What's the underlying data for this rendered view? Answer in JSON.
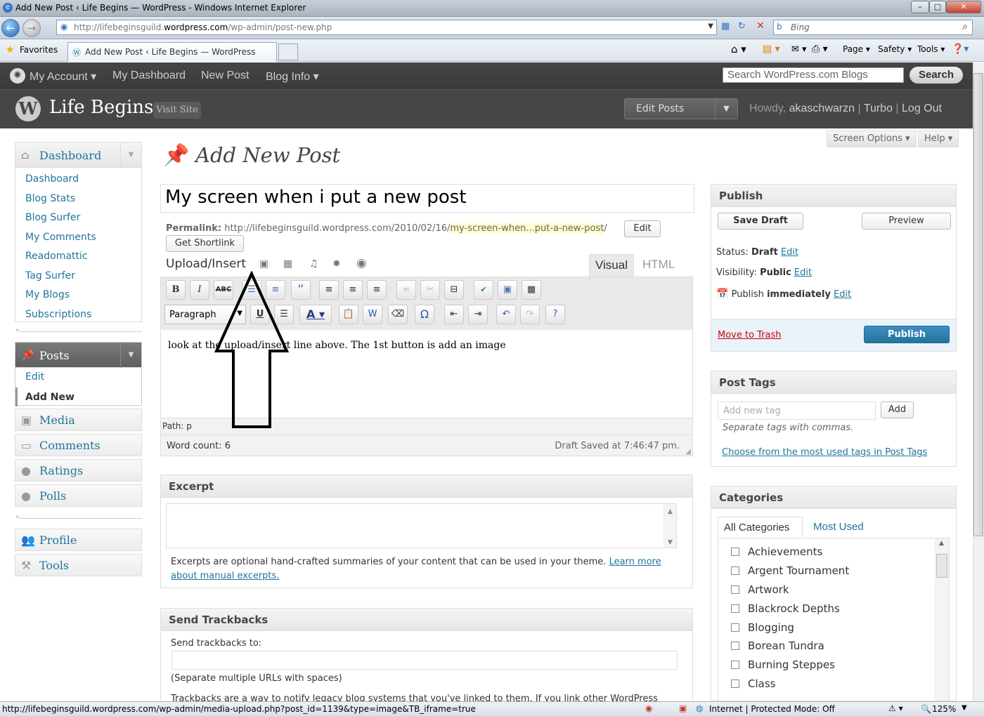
{
  "browser": {
    "window_title": "Add New Post ‹ Life Begins — WordPress - Windows Internet Explorer",
    "url_prefix": "http://lifebeginsguild.",
    "url_domain": "wordpress.com",
    "url_path": "/wp-admin/post-new.php",
    "search_placeholder": "Bing",
    "favorites_label": "Favorites",
    "tab_title": "Add New Post ‹ Life Begins — WordPress",
    "cmd_page": "Page ▾",
    "cmd_safety": "Safety ▾",
    "cmd_tools": "Tools ▾",
    "status_url": "http://lifebeginsguild.wordpress.com/wp-admin/media-upload.php?post_id=1139&type=image&TB_iframe=true",
    "status_zone": "Internet | Protected Mode: Off",
    "zoom": "125%"
  },
  "adminbar": {
    "my_account": "My Account ▾",
    "my_dashboard": "My Dashboard",
    "new_post": "New Post",
    "blog_info": "Blog Info ▾",
    "search_placeholder": "Search WordPress.com Blogs",
    "search_button": "Search"
  },
  "header": {
    "site_title": "Life Begins",
    "visit_site": "Visit Site",
    "edit_posts": "Edit Posts",
    "howdy": "Howdy,",
    "username": "akaschwarzn",
    "turbo": "Turbo",
    "logout": "Log Out",
    "sep": "|"
  },
  "sidebar": {
    "dashboard": "Dashboard",
    "dashboard_items": [
      "Dashboard",
      "Blog Stats",
      "Blog Surfer",
      "My Comments",
      "Readomattic",
      "Tag Surfer",
      "My Blogs",
      "Subscriptions"
    ],
    "posts": "Posts",
    "posts_items": [
      "Edit",
      "Add New"
    ],
    "media": "Media",
    "comments": "Comments",
    "ratings": "Ratings",
    "polls": "Polls",
    "profile": "Profile",
    "tools": "Tools"
  },
  "main": {
    "screen_options": "Screen Options ▾",
    "help": "Help ▾",
    "page_title": "Add New Post",
    "post_title": "My screen when i put a new post",
    "permalink_label": "Permalink:",
    "permalink_base": "http://lifebeginsguild.wordpress.com/2010/02/16/",
    "permalink_slug": "my-screen-when...put-a-new-post",
    "permalink_end": "/",
    "edit_button": "Edit",
    "shortlink_button": "Get Shortlink",
    "upload_insert": "Upload/Insert",
    "tab_visual": "Visual",
    "tab_html": "HTML",
    "format_select": "Paragraph",
    "editor_content": "look at the upload/insert line above. The 1st button is add an image",
    "path": "Path: p",
    "word_count": "Word count: 6",
    "draft_saved": "Draft Saved at 7:46:47 pm.",
    "excerpt_title": "Excerpt",
    "excerpt_help": "Excerpts are optional hand-crafted summaries of your content that can be used in your theme.",
    "excerpt_link": "Learn more about manual excerpts.",
    "trackbacks_title": "Send Trackbacks",
    "trackbacks_label": "Send trackbacks to:",
    "trackbacks_hint": "(Separate multiple URLs with spaces)",
    "trackbacks_more": "Trackbacks are a way to notify legacy blog systems that you've linked to them. If you link other WordPress"
  },
  "publish": {
    "title": "Publish",
    "save_draft": "Save Draft",
    "preview": "Preview",
    "status_label": "Status:",
    "status_value": "Draft",
    "visibility_label": "Visibility:",
    "visibility_value": "Public",
    "publish_label": "Publish",
    "publish_value": "immediately",
    "edit": "Edit",
    "trash": "Move to Trash",
    "publish_button": "Publish"
  },
  "tags": {
    "title": "Post Tags",
    "placeholder": "Add new tag",
    "add_button": "Add",
    "hint": "Separate tags with commas.",
    "choose_link": "Choose from the most used tags in Post Tags"
  },
  "categories": {
    "title": "Categories",
    "tab_all": "All Categories",
    "tab_most": "Most Used",
    "items": [
      "Achievements",
      "Argent Tournament",
      "Artwork",
      "Blackrock Depths",
      "Blogging",
      "Borean Tundra",
      "Burning Steppes",
      "Class"
    ]
  }
}
